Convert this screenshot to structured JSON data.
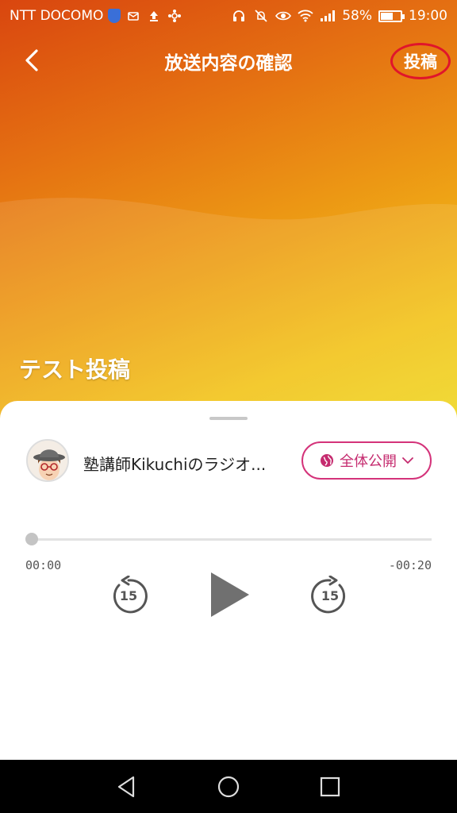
{
  "status_bar": {
    "carrier": "NTT DOCOMO",
    "battery_percent": "58%",
    "battery_level": 0.58,
    "time": "19:00",
    "icons": [
      "shield-icon",
      "sms-icon",
      "upload-icon",
      "sync-icon",
      "headphones-icon",
      "mute-icon",
      "eye-icon",
      "wifi-icon",
      "signal-icon",
      "battery-icon"
    ]
  },
  "header": {
    "title": "放送内容の確認",
    "post_label": "投稿",
    "post_highlight_color": "#e0152b"
  },
  "episode": {
    "title": "テスト投稿"
  },
  "channel": {
    "name": "塾講師Kikuchiのラジオ...",
    "visibility_label": "全体公開",
    "accent_color": "#d4337a"
  },
  "player": {
    "current_time": "00:00",
    "remaining_time": "-00:20",
    "progress": 0,
    "rewind_seconds": "15",
    "forward_seconds": "15"
  },
  "navigation": {
    "icons": [
      "nav-back-icon",
      "nav-home-icon",
      "nav-recent-icon"
    ]
  }
}
